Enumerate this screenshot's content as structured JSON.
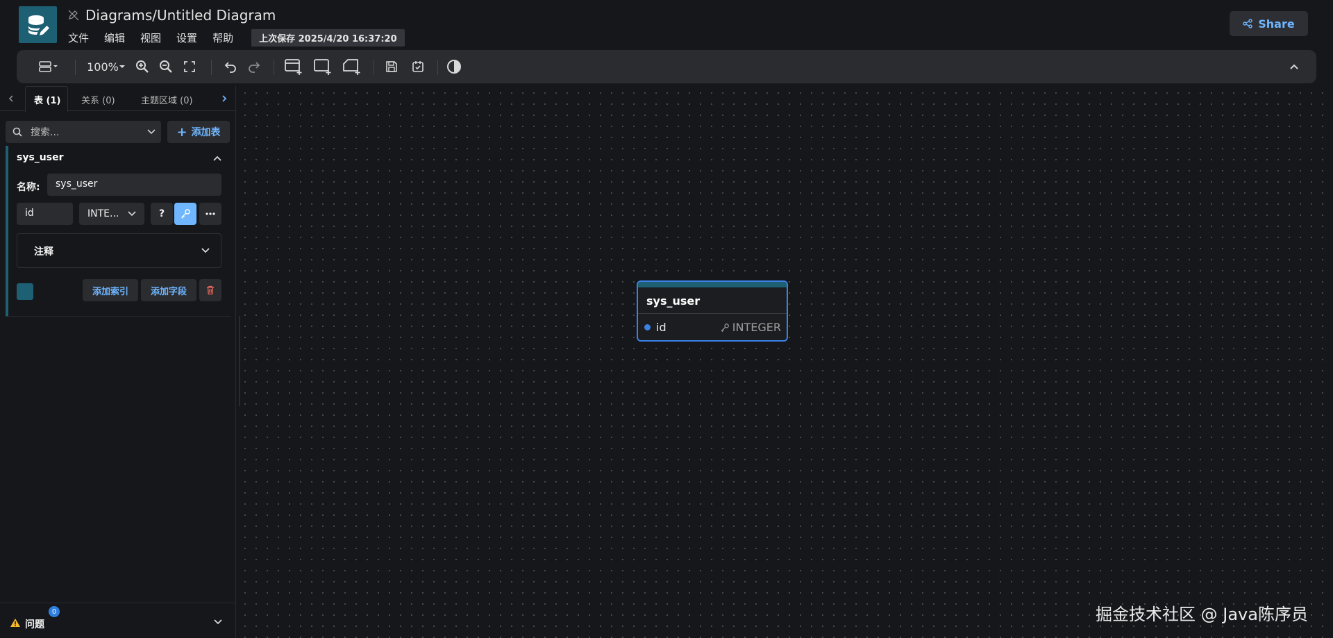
{
  "header": {
    "title": "Diagrams/Untitled Diagram",
    "menu": [
      "文件",
      "编辑",
      "视图",
      "设置",
      "帮助"
    ],
    "last_saved": "上次保存 2025/4/20 16:37:20",
    "share_label": "Share"
  },
  "toolbar": {
    "zoom": "100%"
  },
  "sidebar": {
    "tabs": [
      "表 (1)",
      "关系 (0)",
      "主题区域 (0)"
    ],
    "search_placeholder": "搜索...",
    "add_table_label": "添加表",
    "table": {
      "name": "sys_user",
      "name_label": "名称:",
      "name_value": "sys_user",
      "field_name": "id",
      "field_type": "INTE...",
      "help_label": "?",
      "comment_label": "注释",
      "color": "#1d5f73",
      "add_index_label": "添加索引",
      "add_field_label": "添加字段"
    },
    "issues_label": "问题",
    "issues_count": "0"
  },
  "canvas": {
    "table": {
      "name": "sys_user",
      "field_name": "id",
      "field_type": "INTEGER",
      "border_color": "#3b82e6",
      "header_color": "#1d5f73"
    }
  },
  "watermark": "掘金技术社区 @ Java陈序员"
}
